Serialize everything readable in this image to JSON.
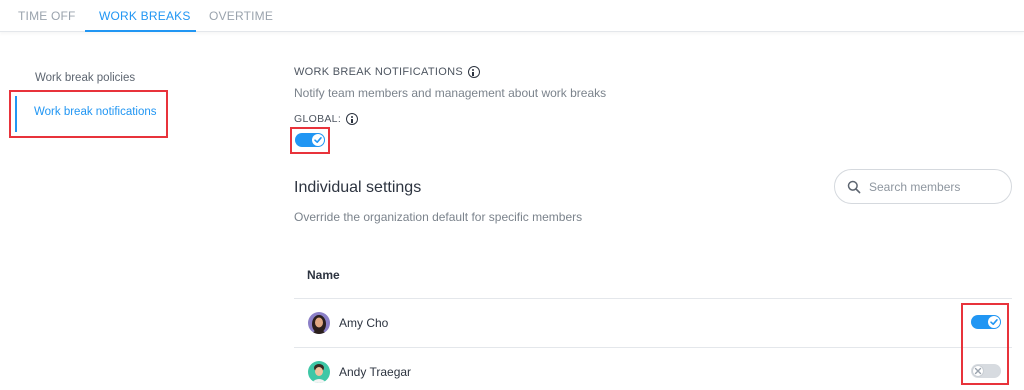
{
  "tabs": [
    {
      "label": "TIME OFF"
    },
    {
      "label": "WORK BREAKS",
      "active": true
    },
    {
      "label": "OVERTIME"
    }
  ],
  "sidebar": {
    "items": [
      {
        "label": "Work break policies"
      },
      {
        "label": "Work break notifications",
        "active": true
      }
    ]
  },
  "notifications": {
    "title": "WORK BREAK NOTIFICATIONS",
    "description": "Notify team members and management about work breaks",
    "global_label": "GLOBAL:",
    "global_enabled": true
  },
  "individual": {
    "title": "Individual settings",
    "description": "Override the organization default for specific members",
    "search_placeholder": "Search members",
    "column_name": "Name",
    "members": [
      {
        "name": "Amy Cho",
        "enabled": true
      },
      {
        "name": "Andy Traegar",
        "enabled": false
      }
    ]
  },
  "colors": {
    "accent": "#2196f3",
    "highlight": "#e8333b",
    "toggle_off": "#d7dbe0"
  },
  "icons": [
    "info-icon",
    "search-icon",
    "check-icon",
    "x-icon"
  ]
}
